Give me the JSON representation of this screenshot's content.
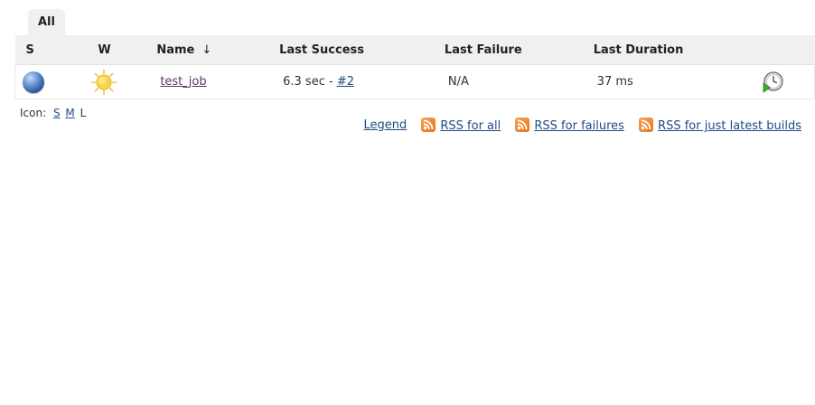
{
  "tabs": [
    {
      "label": "All",
      "active": true
    }
  ],
  "table": {
    "headers": {
      "status": "S",
      "weather": "W",
      "name": "Name",
      "sort_indicator": "↓",
      "last_success": "Last Success",
      "last_failure": "Last Failure",
      "last_duration": "Last Duration"
    },
    "rows": [
      {
        "status_icon": "blue-ball-icon",
        "weather_icon": "sun-icon",
        "name": "test_job",
        "last_success_time": "6.3 sec",
        "last_success_sep": " - ",
        "last_success_build": "#2",
        "last_failure": "N/A",
        "last_duration": "37 ms",
        "action_icon": "schedule-build-icon"
      }
    ]
  },
  "icon_size": {
    "label": "Icon:",
    "small": "S",
    "medium": "M",
    "large": "L"
  },
  "footer_links": {
    "legend": "Legend",
    "rss_all": "RSS for all",
    "rss_failures": "RSS for failures",
    "rss_latest": "RSS for just latest builds"
  },
  "colors": {
    "link": "#204a87",
    "visited_link": "#5c3566",
    "header_bg": "#f0f0f0",
    "rss_orange": "#e8751a"
  }
}
